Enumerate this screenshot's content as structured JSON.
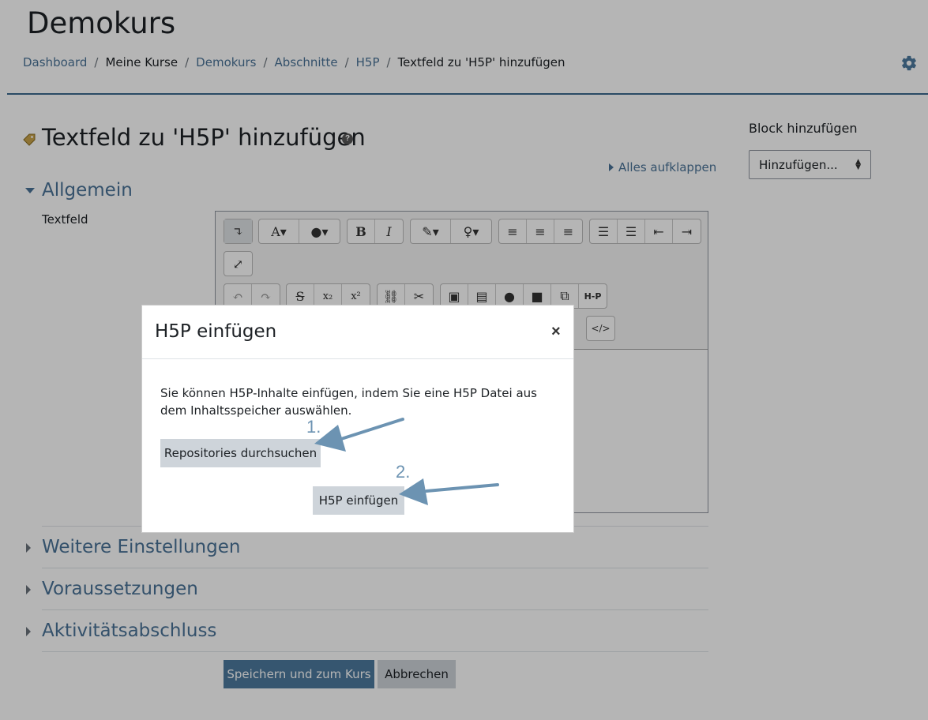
{
  "page": {
    "title": "Demokurs",
    "breadcrumb": [
      {
        "label": "Dashboard",
        "link": true
      },
      {
        "label": "Meine Kurse",
        "link": false
      },
      {
        "label": "Demokurs",
        "link": true
      },
      {
        "label": "Abschnitte",
        "link": true
      },
      {
        "label": "H5P",
        "link": true
      },
      {
        "label": "Textfeld zu 'H5P' hinzufügen",
        "link": false
      }
    ],
    "settings_icon": "gear-icon"
  },
  "form": {
    "heading": "Textfeld zu 'H5P' hinzufügen",
    "heading_icon": "tag-icon",
    "help_icon": "question-circle-icon",
    "expand_all": "Alles aufklappen",
    "sections": {
      "general": "Allgemein",
      "more": "Weitere Einstellungen",
      "restrictions": "Voraussetzungen",
      "completion": "Aktivitätsabschluss"
    },
    "field_label": "Textfeld",
    "save_label": "Speichern und zum Kurs",
    "cancel_label": "Abbrechen"
  },
  "block": {
    "title": "Block hinzufügen",
    "select_value": "Hinzufügen..."
  },
  "toolbar": {
    "row1": [
      "collapse-icon",
      "font-icon",
      "color-icon",
      "bold-icon",
      "italic-icon",
      "brush-icon",
      "lightbulb-icon",
      "align-left-icon",
      "align-center-icon",
      "align-right-icon",
      "bullet-list-icon",
      "numbered-list-icon",
      "outdent-icon",
      "indent-icon"
    ],
    "row2": [
      "fullscreen-icon"
    ],
    "row3": [
      "undo-icon",
      "redo-icon",
      "strikethrough-icon",
      "subscript-icon",
      "superscript-icon",
      "link-icon",
      "unlink-icon",
      "image-icon",
      "media-icon",
      "microphone-icon",
      "video-icon",
      "paste-icon",
      "h5p-icon"
    ],
    "row4": [
      "html-icon"
    ],
    "h5p_label": "H-P"
  },
  "modal": {
    "title": "H5P einfügen",
    "close": "×",
    "text": "Sie können H5P-Inhalte einfügen, indem Sie eine H5P Datei aus dem Inhaltsspeicher auswählen.",
    "browse_label": "Repositories durchsuchen",
    "insert_label": "H5P einfügen"
  },
  "annotations": {
    "step1": "1.",
    "step2": "2.",
    "arrow_color": "#6c93b2"
  },
  "colors": {
    "accent": "#4d7a9e",
    "link": "#4a7397"
  }
}
